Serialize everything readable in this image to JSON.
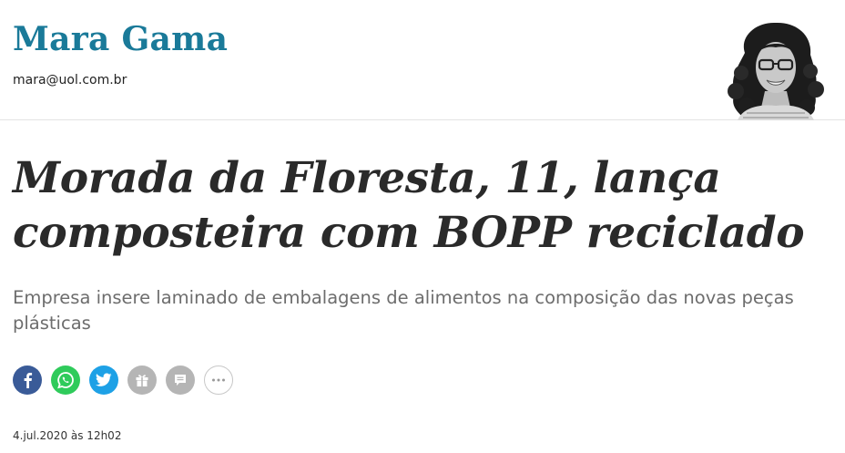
{
  "author": {
    "name": "Mara Gama",
    "email": "mara@uol.com.br"
  },
  "article": {
    "headline_line1": "Morada da Floresta, 11, lança",
    "headline_line2": "composteira com BOPP reciclado",
    "subtitle": "Empresa insere laminado de embalagens de alimentos na composição das novas peças plásticas",
    "date": "4.jul.2020 às 12h02"
  },
  "share": {
    "icons": [
      "facebook-icon",
      "whatsapp-icon",
      "twitter-icon",
      "gift-icon",
      "comment-icon",
      "more-icon"
    ],
    "colors": {
      "facebook": "#3a5b98",
      "whatsapp": "#2fcb5b",
      "twitter": "#1ea1e6",
      "gift": "#b5b5b5",
      "comment": "#b5b5b5"
    }
  },
  "colors": {
    "author_name": "#1a7a99",
    "headline": "#2a2a2a",
    "subtitle": "#6d6d6d"
  }
}
